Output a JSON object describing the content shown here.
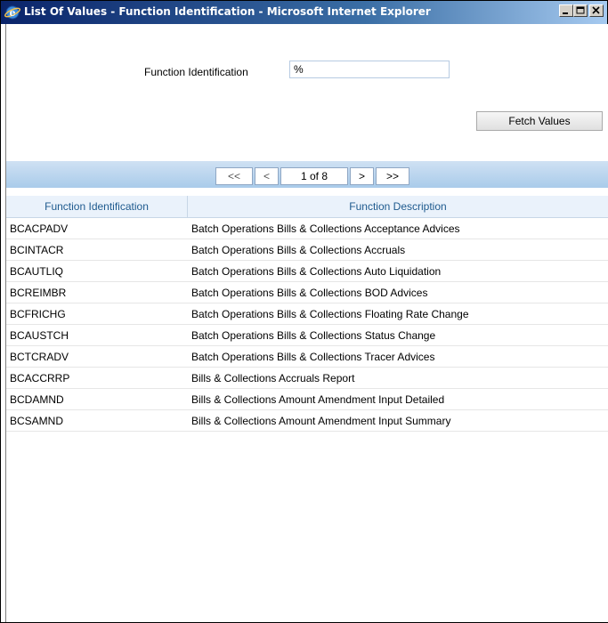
{
  "window": {
    "title": "List Of Values - Function Identification - Microsoft Internet Explorer"
  },
  "search": {
    "label": "Function Identification",
    "value": "%"
  },
  "fetch_button": "Fetch Values",
  "pager": {
    "first": "<<",
    "prev": "<",
    "page": "1 of 8",
    "next": ">",
    "last": ">>"
  },
  "table": {
    "columns": [
      "Function Identification",
      "Function Description"
    ],
    "rows": [
      [
        "BCACPADV",
        "Batch Operations Bills & Collections Acceptance Advices"
      ],
      [
        "BCINTACR",
        "Batch Operations Bills & Collections Accruals"
      ],
      [
        "BCAUTLIQ",
        "Batch Operations Bills & Collections Auto Liquidation"
      ],
      [
        "BCREIMBR",
        "Batch Operations Bills & Collections BOD Advices"
      ],
      [
        "BCFRICHG",
        "Batch Operations Bills & Collections Floating Rate Change"
      ],
      [
        "BCAUSTCH",
        "Batch Operations Bills & Collections Status Change"
      ],
      [
        "BCTCRADV",
        "Batch Operations Bills & Collections Tracer Advices"
      ],
      [
        "BCACCRRP",
        "Bills & Collections Accruals Report"
      ],
      [
        "BCDAMND",
        "Bills & Collections Amount Amendment Input Detailed"
      ],
      [
        "BCSAMND",
        "Bills & Collections Amount Amendment Input Summary"
      ]
    ]
  }
}
